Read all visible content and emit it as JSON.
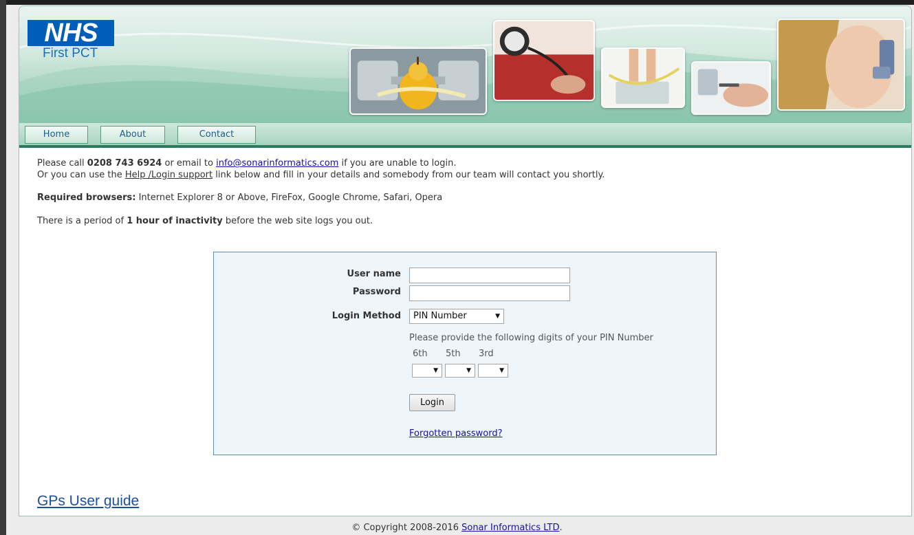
{
  "header": {
    "logo_text": "NHS",
    "org_name": "First PCT"
  },
  "nav": {
    "items": [
      {
        "label": "Home"
      },
      {
        "label": "About"
      },
      {
        "label": "Contact"
      }
    ]
  },
  "info": {
    "line1_prefix": "Please call ",
    "phone": "0208 743 6924",
    "line1_mid": " or email to ",
    "email": "info@sonarinformatics.com",
    "line1_suffix": " if you are unable to login.",
    "line2_prefix": "Or you can use the ",
    "support_link": "Help /Login support",
    "line2_suffix": " link below and fill in your details and somebody from our team will contact you shortly.",
    "browsers_label": "Required browsers:",
    "browsers_text": " Internet Explorer 8 or Above, FireFox, Google Chrome, Safari, Opera",
    "inactivity_prefix": "There is a period of ",
    "inactivity_bold": "1 hour of inactivity",
    "inactivity_suffix": " before the web site logs you out."
  },
  "login": {
    "username_label": "User name",
    "username_value": "",
    "password_label": "Password",
    "password_value": "",
    "method_label": "Login Method",
    "method_selected": "PIN Number",
    "pin_instruction": "Please provide the following digits of your PIN Number",
    "digits": [
      {
        "label": "6th",
        "value": ""
      },
      {
        "label": "5th",
        "value": ""
      },
      {
        "label": "3rd",
        "value": ""
      }
    ],
    "login_button": "Login",
    "forgot_link": "Forgotten password?"
  },
  "links": {
    "user_guide": "GPs User guide"
  },
  "footer": {
    "copyright": "© Copyright 2008-2016 ",
    "company_link": "Sonar Informatics LTD",
    "end": "."
  },
  "colors": {
    "nhs_blue": "#005eb8",
    "nav_green": "#2a7a5e",
    "login_bg": "#eef5fb",
    "link_blue": "#1a0dab"
  },
  "icons": {
    "select_arrow": "dropdown-arrow-icon"
  }
}
